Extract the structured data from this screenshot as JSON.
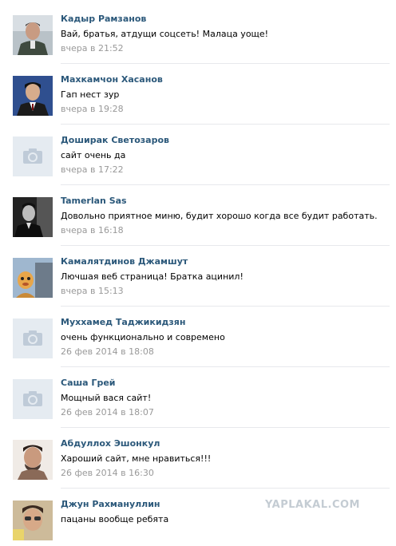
{
  "comments": [
    {
      "author": "Кадыр Рамзанов",
      "text": "Вай, братья, атдущи соцсеть! Малаца уоще!",
      "date": "вчера в 21:52",
      "avatar": "photo-man-uniform"
    },
    {
      "author": "Махкамчон Хасанов",
      "text": "Гап нест зур",
      "date": "вчера в 19:28",
      "avatar": "photo-man-suit"
    },
    {
      "author": "Доширак Светозаров",
      "text": "сайт очень да",
      "date": "вчера в 17:22",
      "avatar": "camera-placeholder-icon"
    },
    {
      "author": "Tamerlan Sas",
      "text": "Довольно приятное миню, будит хорошо когда все будит работать.",
      "date": "вчера в 16:18",
      "avatar": "photo-bw"
    },
    {
      "author": "Камалятдинов Джамшут",
      "text": "Лючшая веб страница! Братка ацинил!",
      "date": "вчера в 15:13",
      "avatar": "photo-cartoon"
    },
    {
      "author": "Мухxамед Таджикидзян",
      "text": "очень функционально и современо",
      "date": "26 фев 2014 в 18:08",
      "avatar": "camera-placeholder-icon"
    },
    {
      "author": "Саша Грей",
      "text": "Мощный вася сайт!",
      "date": "26 фев 2014 в 18:07",
      "avatar": "camera-placeholder-icon"
    },
    {
      "author": "Абдуллох Эшонкул",
      "text": "Хароший сайт, мне нравиться!!!",
      "date": "26 фев 2014 в 16:30",
      "avatar": "photo-young-man"
    },
    {
      "author": "Джун Рахманullин",
      "text": "пацаны вообще ребята",
      "date": "",
      "avatar": "photo-man-selfie"
    }
  ],
  "watermark": "YAPLAKAL.COM",
  "colors": {
    "author": "#2b587a",
    "date": "#999999",
    "divider": "#e7e8ec",
    "placeholder_bg": "#e5ebf1",
    "placeholder_icon": "#bfcbd8"
  }
}
